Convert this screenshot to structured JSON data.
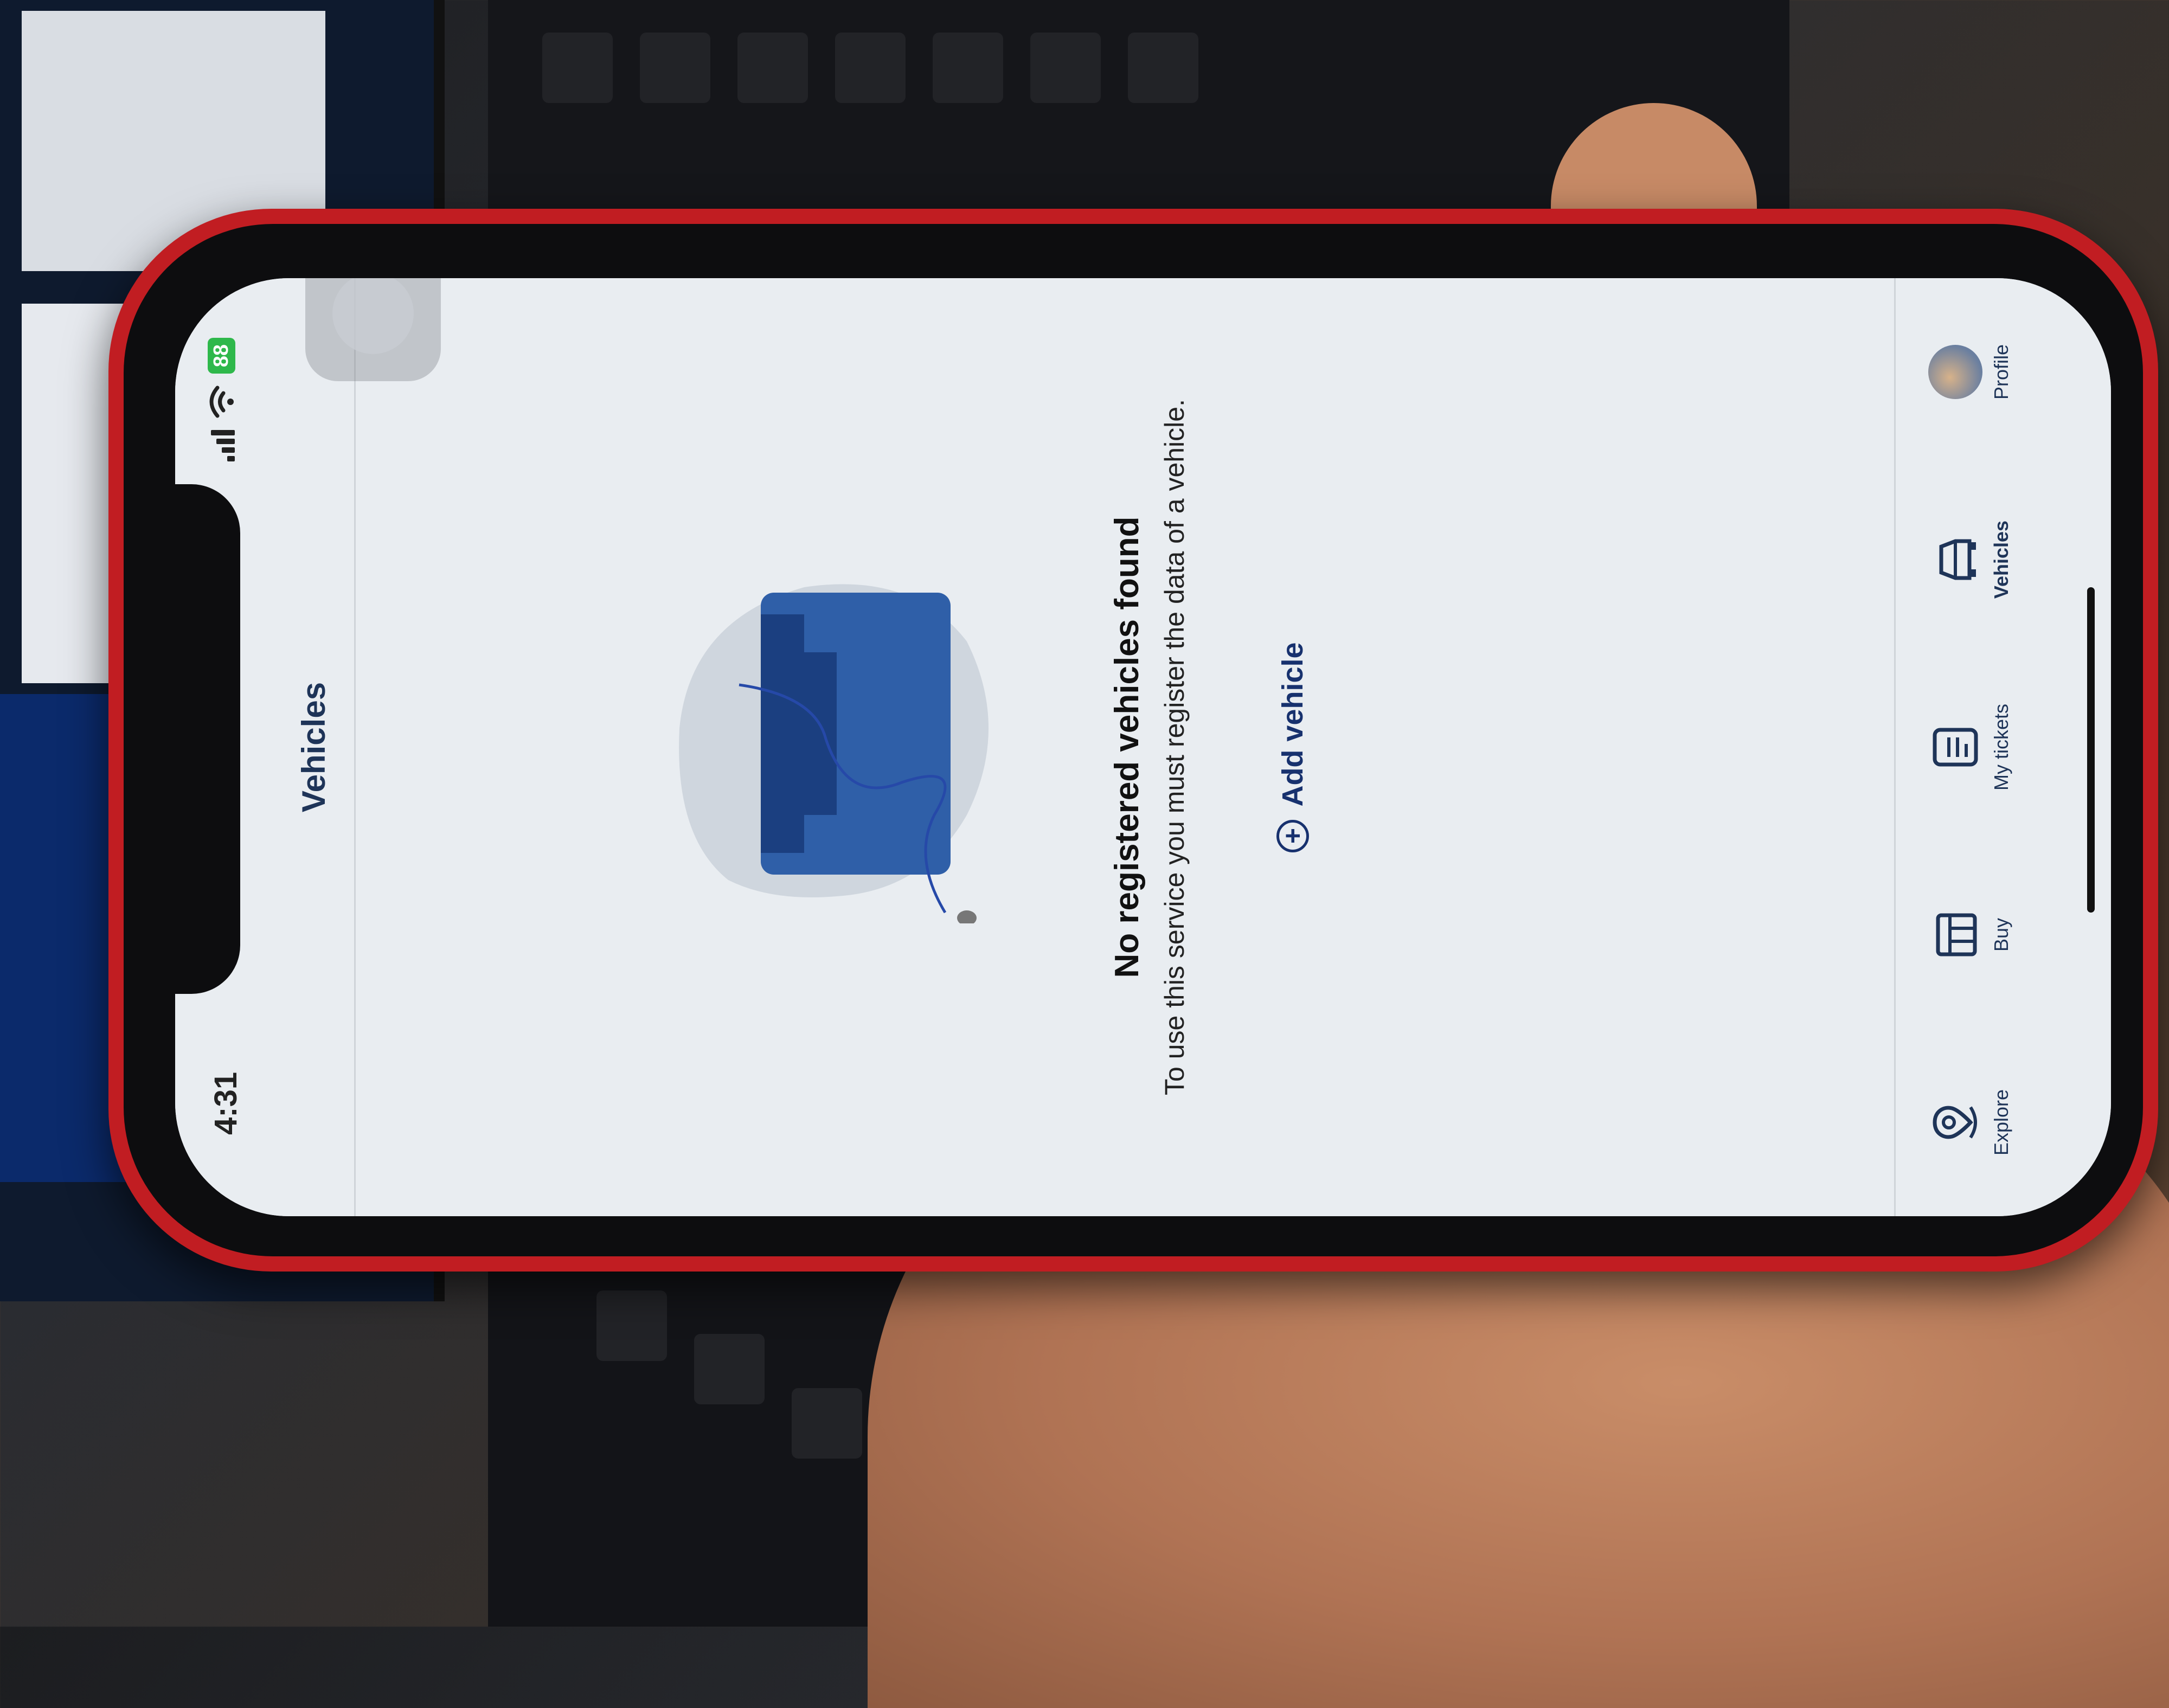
{
  "status_bar": {
    "time": "4:31",
    "battery": "88"
  },
  "header": {
    "title": "Vehicles"
  },
  "empty_state": {
    "title": "No registered vehicles found",
    "description": "To use this service you must register the data of a vehicle.",
    "add_label": "Add vehicle"
  },
  "tabs": [
    {
      "label": "Explore",
      "icon": "map-pin-icon"
    },
    {
      "label": "Buy",
      "icon": "parking-lot-icon"
    },
    {
      "label": "My tickets",
      "icon": "ticket-icon"
    },
    {
      "label": "Vehicles",
      "icon": "car-icon",
      "active": true
    },
    {
      "label": "Profile",
      "icon": "avatar"
    }
  ],
  "colors": {
    "accent": "#17316e",
    "background": "#e9edf1",
    "phone_case": "#c11d22"
  }
}
